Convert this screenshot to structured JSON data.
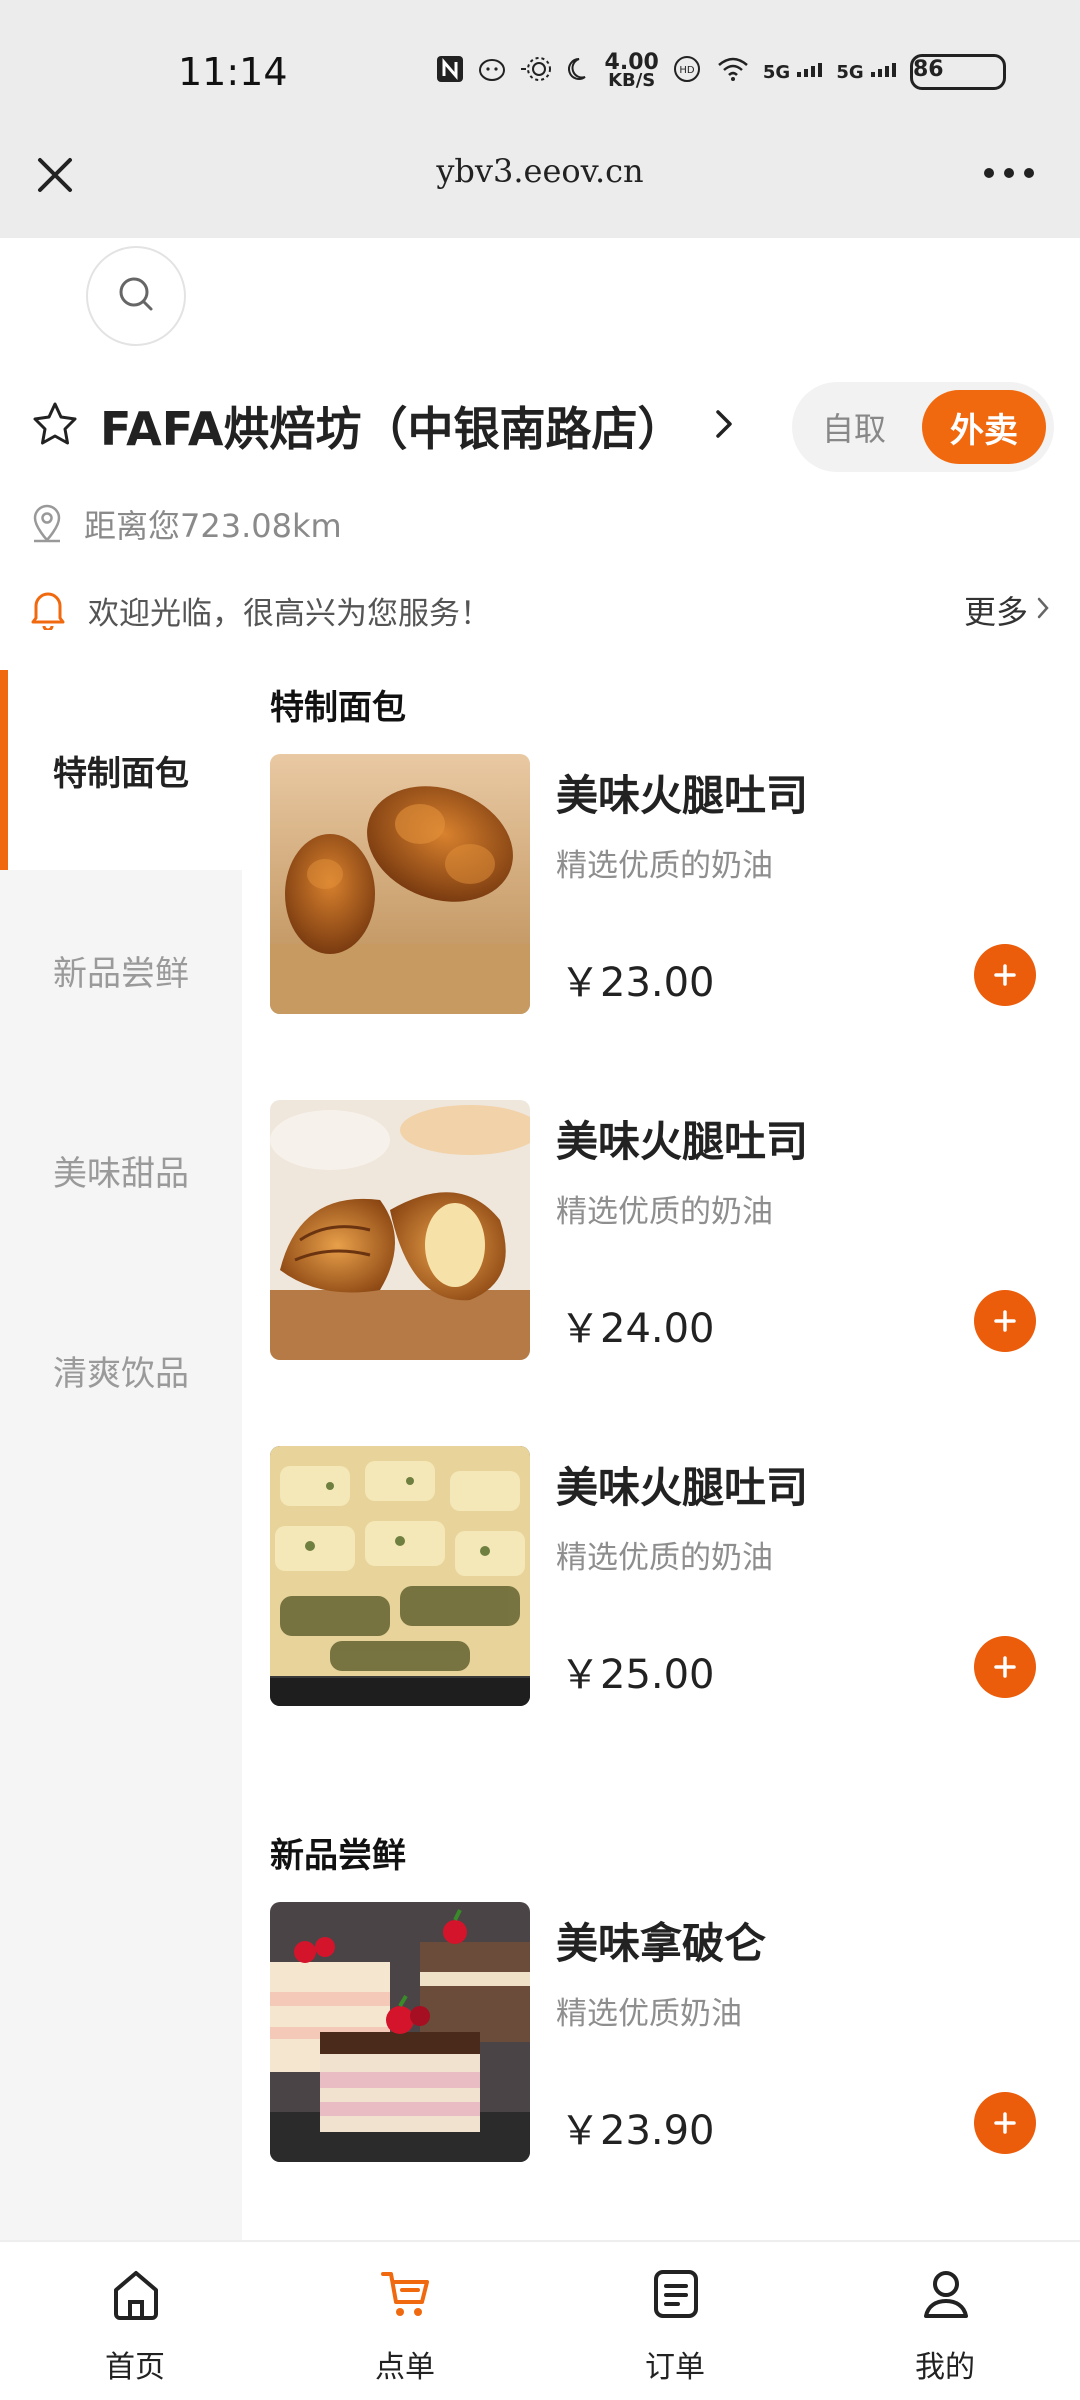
{
  "status_bar": {
    "time": "11:14",
    "net_speed_value": "4.00",
    "net_speed_unit": "KB/S",
    "signal_1": "5G",
    "signal_2": "5G",
    "battery": "86"
  },
  "browser": {
    "url": "ybv3.eeov.cn"
  },
  "store": {
    "name": "FAFA烘焙坊（中银南路店）",
    "distance": "距离您723.08km",
    "notice": "欢迎光临，很高兴为您服务！",
    "notice_more": "更多",
    "mode_pickup": "自取",
    "mode_delivery": "外卖"
  },
  "categories": [
    {
      "label": "特制面包",
      "active": true
    },
    {
      "label": "新品尝鲜",
      "active": false
    },
    {
      "label": "美味甜品",
      "active": false
    },
    {
      "label": "清爽饮品",
      "active": false
    }
  ],
  "sections": [
    {
      "title": "特制面包",
      "products": [
        {
          "name": "美味火腿吐司",
          "desc": "精选优质的奶油",
          "price": "￥23.00",
          "image": "braided-bread"
        },
        {
          "name": "美味火腿吐司",
          "desc": "精选优质的奶油",
          "price": "￥24.00",
          "image": "croissant"
        },
        {
          "name": "美味火腿吐司",
          "desc": "精选优质的奶油",
          "price": "￥25.00",
          "image": "herb-pastry"
        }
      ]
    },
    {
      "title": "新品尝鲜",
      "products": [
        {
          "name": "美味拿破仑",
          "desc": "精选优质奶油",
          "price": "￥23.90",
          "image": "layer-cake"
        }
      ]
    }
  ],
  "tabbar": [
    {
      "label": "首页",
      "icon": "home-icon",
      "active": false
    },
    {
      "label": "点单",
      "icon": "cart-icon",
      "active": true
    },
    {
      "label": "订单",
      "icon": "orders-icon",
      "active": false
    },
    {
      "label": "我的",
      "icon": "profile-icon",
      "active": false
    }
  ],
  "colors": {
    "accent": "#f1690e",
    "sidebar_bg": "#f5f5f5",
    "bar_bg": "#ececec"
  }
}
